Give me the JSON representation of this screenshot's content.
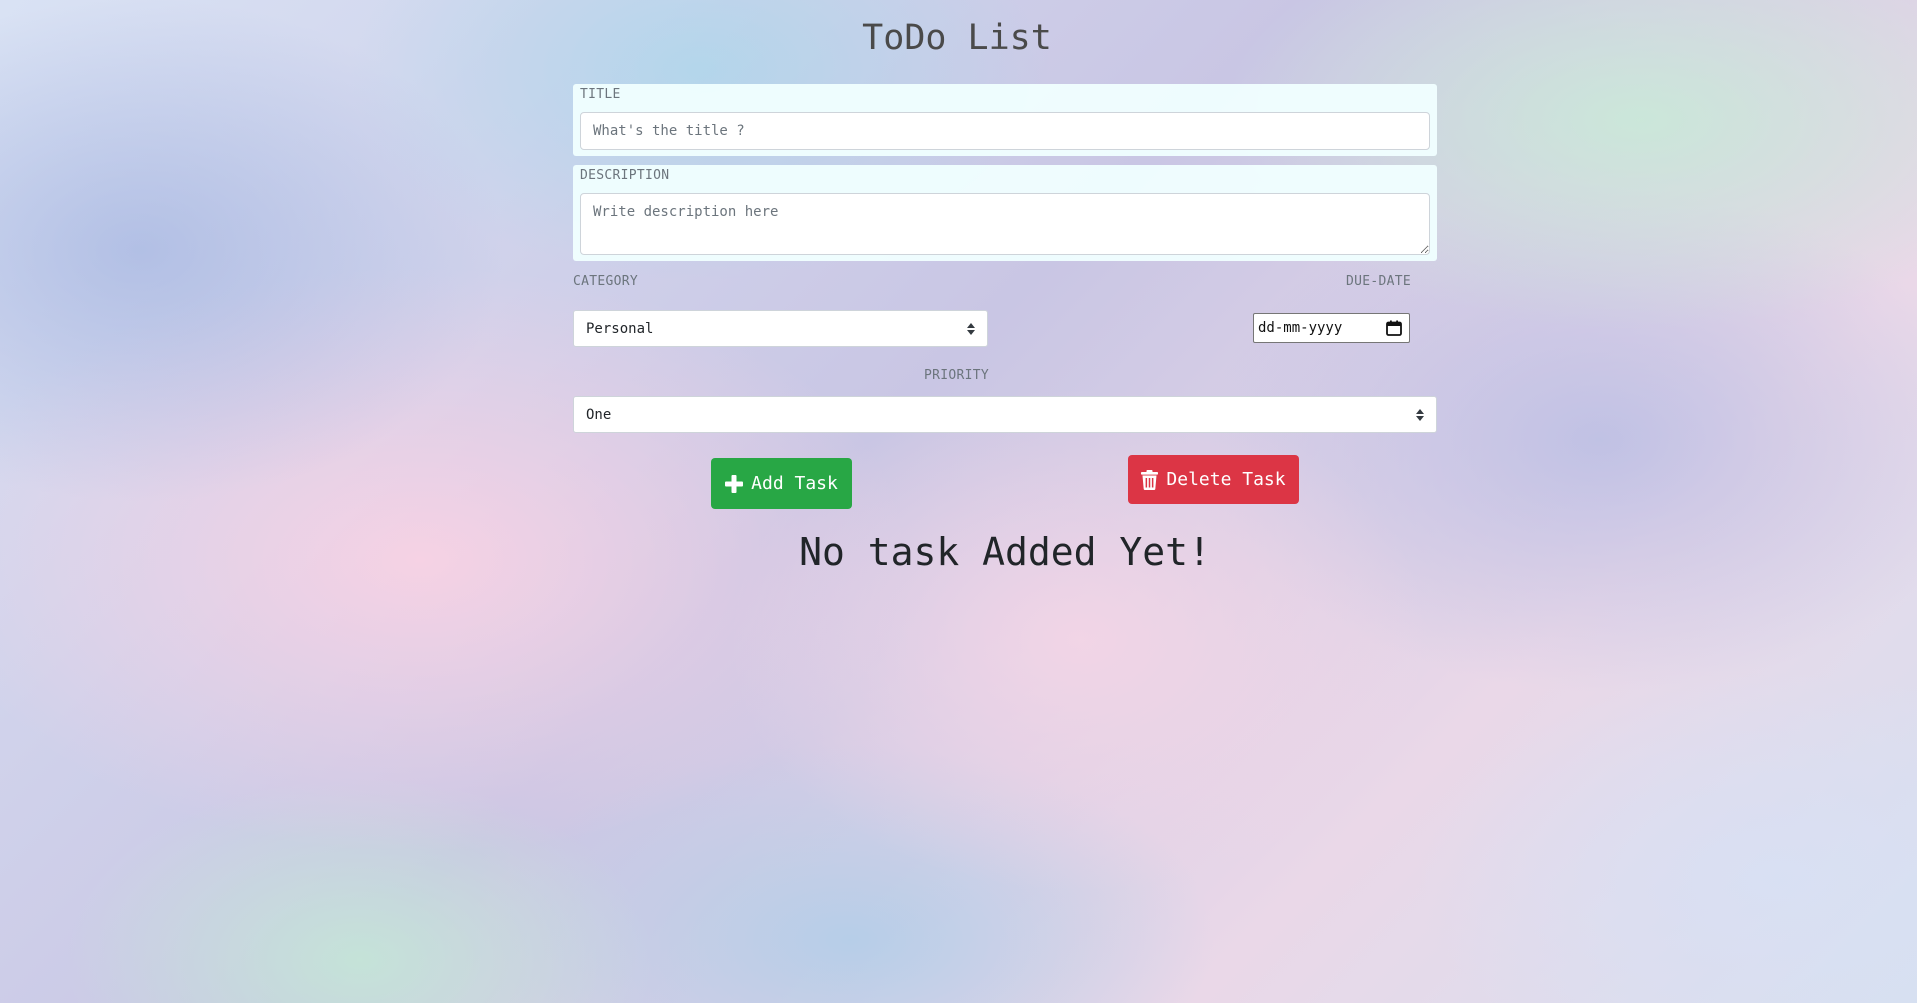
{
  "header": {
    "title": "ToDo List"
  },
  "form": {
    "title_label": "TITLE",
    "title_placeholder": "What's the title ?",
    "description_label": "DESCRIPTION",
    "description_placeholder": "Write description here",
    "category_label": "CATEGORY",
    "category_value": "Personal",
    "due_date_label": "DUE-DATE",
    "due_date_placeholder": "dd-mm-yyyy",
    "priority_label": "PRIORITY",
    "priority_value": "One"
  },
  "actions": {
    "add_label": "Add Task",
    "delete_label": "Delete Task",
    "add_color": "#28a745",
    "delete_color": "#dc3545"
  },
  "tasks": {
    "empty_message": "No task Added Yet!"
  },
  "icons": {
    "add": "plus-icon",
    "delete": "trash-icon",
    "calendar": "calendar-icon",
    "select": "select-arrows-icon"
  }
}
